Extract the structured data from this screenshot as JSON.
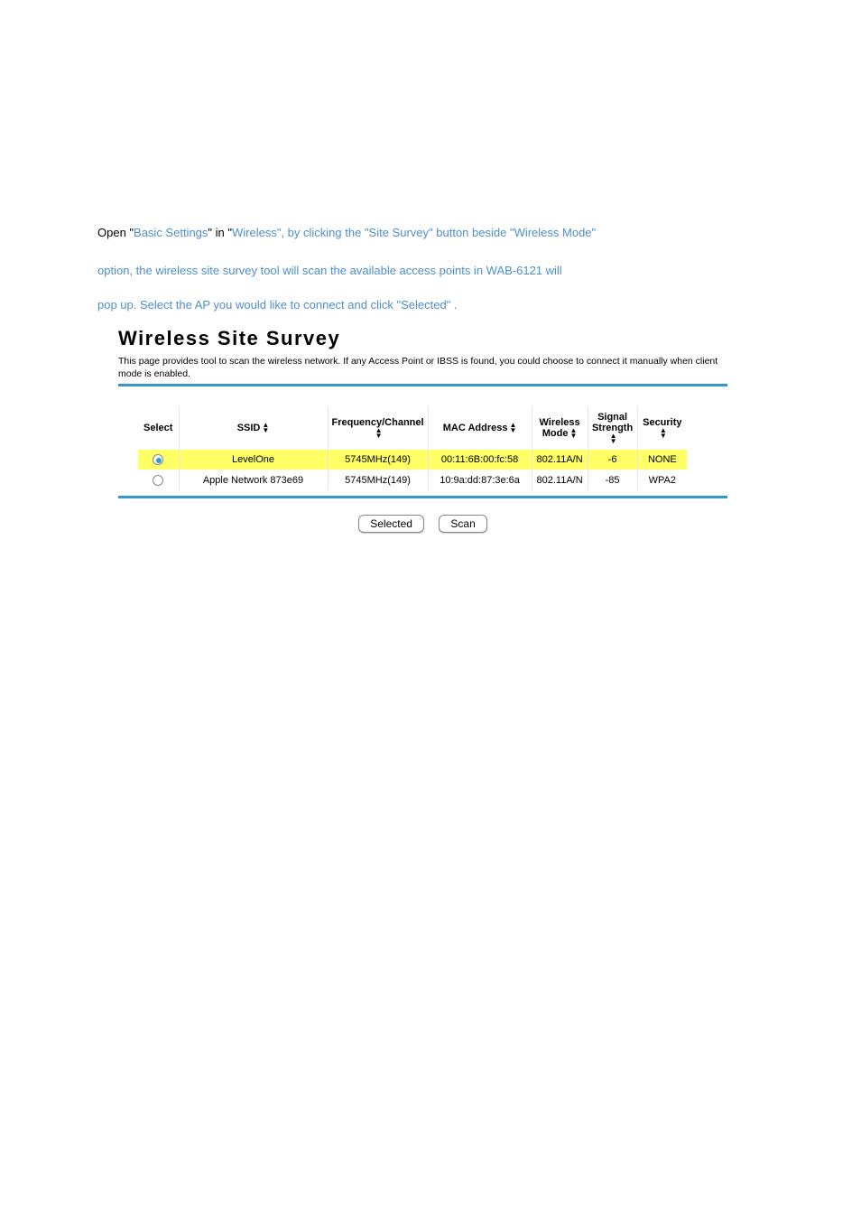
{
  "paragraph1": {
    "open": "Open \"",
    "t1": "Basic Settings",
    "q1": "\" in \"",
    "t2": "Wireless",
    "q2": "\", by clicking the \"",
    "t3": "Site Survey",
    "q3": "\" button beside \"",
    "t4": "Wireless Mode",
    "q4": "\""
  },
  "paragraph2": "option, the wireless site survey tool will scan the available access points in WAB-6121 will",
  "paragraph3": "pop up. Select the AP you would like to connect and click \"Selected\" .",
  "screenshotTitle": "Wireless Site Survey",
  "screenshotDesc": "This page provides tool to scan the wireless network. If any Access Point or IBSS is found, you could choose to connect it manually when client mode is enabled.",
  "headers": {
    "select": "Select",
    "ssid": "SSID",
    "freq": "Frequency/Channel",
    "mac": "MAC Address",
    "mode": "Wireless Mode",
    "signal": "Signal Strength",
    "security": "Security"
  },
  "rows": [
    {
      "ssid": "LevelOne",
      "freq": "5745MHz(149)",
      "mac": "00:11:6B:00:fc:58",
      "mode": "802.11A/N",
      "signal": "-6",
      "security": "NONE",
      "selected": true
    },
    {
      "ssid": "Apple Network 873e69",
      "freq": "5745MHz(149)",
      "mac": "10:9a:dd:87:3e:6a",
      "mode": "802.11A/N",
      "signal": "-85",
      "security": "WPA2",
      "selected": false
    }
  ],
  "buttons": {
    "selected": "Selected",
    "scan": "Scan"
  }
}
